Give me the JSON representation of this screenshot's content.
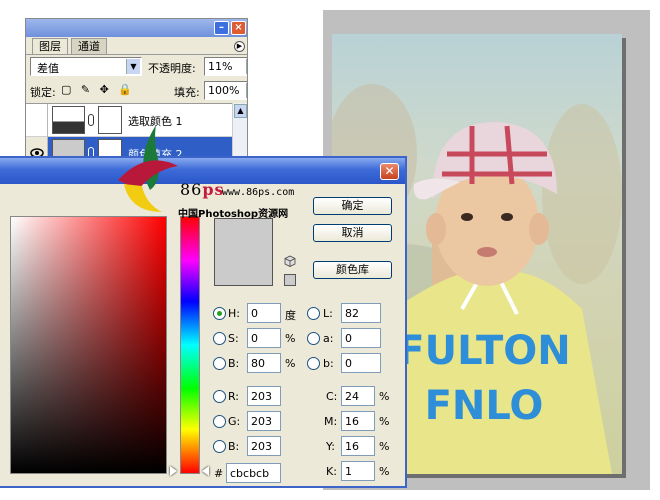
{
  "layers_panel": {
    "tabs": [
      "图层",
      "通道"
    ],
    "blend_mode": "差值",
    "opacity_label": "不透明度:",
    "opacity_value": "11%",
    "lock_label": "锁定:",
    "lock_icons": "▢ ✎ ✥ 🔒",
    "fill_label": "填充:",
    "fill_value": "100%",
    "layers": [
      {
        "name": "选取颜色 1",
        "selected": false
      },
      {
        "name": "颜色填充 2",
        "selected": true
      }
    ]
  },
  "picker": {
    "buttons": {
      "ok": "确定",
      "cancel": "取消",
      "library": "颜色库"
    },
    "current_color": "#cbcbcb",
    "hsb": {
      "h": {
        "label": "H:",
        "value": "0",
        "unit": "度"
      },
      "s": {
        "label": "S:",
        "value": "0",
        "unit": "%"
      },
      "b": {
        "label": "B:",
        "value": "80",
        "unit": "%"
      }
    },
    "lab": {
      "l": {
        "label": "L:",
        "value": "82"
      },
      "a": {
        "label": "a:",
        "value": "0"
      },
      "b": {
        "label": "b:",
        "value": "0"
      }
    },
    "rgb": {
      "r": {
        "label": "R:",
        "value": "203"
      },
      "g": {
        "label": "G:",
        "value": "203"
      },
      "b": {
        "label": "B:",
        "value": "203"
      }
    },
    "cmyk": {
      "c": {
        "label": "C:",
        "value": "24",
        "unit": "%"
      },
      "m": {
        "label": "M:",
        "value": "16",
        "unit": "%"
      },
      "y": {
        "label": "Y:",
        "value": "16",
        "unit": "%"
      },
      "k": {
        "label": "K:",
        "value": "1",
        "unit": "%"
      }
    },
    "hex_label": "#",
    "hex_value": "cbcbcb"
  },
  "watermark": {
    "brand": "86",
    "brand_ps": "ps",
    "url": "www.86ps.com",
    "cn": "中国Photoshop资源网"
  },
  "photo": {
    "shirt_text_1": "FULTON",
    "shirt_text_2": "FNLO"
  },
  "icons": {
    "eye": "eye-icon",
    "chain": "link-icon",
    "close": "close-icon",
    "cube": "web-cube-icon"
  }
}
